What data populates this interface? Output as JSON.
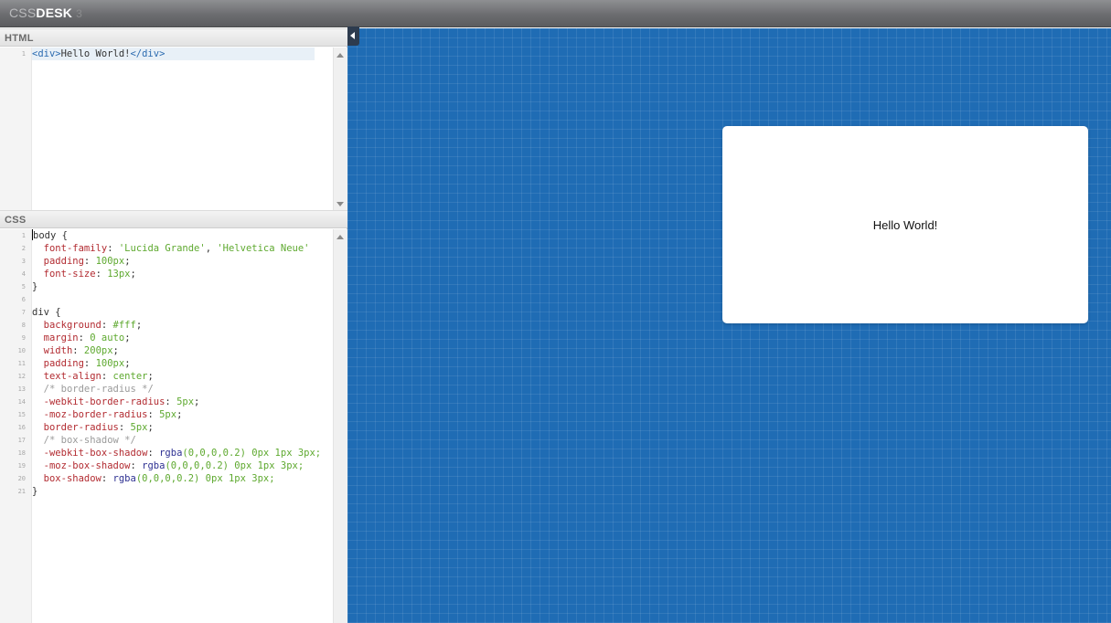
{
  "app": {
    "logo_part1": "CSS",
    "logo_part2": "DESK",
    "logo_part3": "3"
  },
  "html_panel": {
    "title": "HTML",
    "lines": [
      [
        [
          "tag",
          "<div>"
        ],
        [
          "txt",
          "Hello World!"
        ],
        [
          "tag",
          "</div>"
        ]
      ]
    ]
  },
  "css_panel": {
    "title": "CSS",
    "lines": [
      [
        [
          "sel",
          "body {"
        ]
      ],
      [
        [
          "txt",
          "  "
        ],
        [
          "prop",
          "font-family"
        ],
        [
          "txt",
          ": "
        ],
        [
          "val",
          "'Lucida Grande'"
        ],
        [
          "txt",
          ", "
        ],
        [
          "val",
          "'Helvetica Neue'"
        ]
      ],
      [
        [
          "txt",
          "  "
        ],
        [
          "prop",
          "padding"
        ],
        [
          "txt",
          ": "
        ],
        [
          "val",
          "100px"
        ],
        [
          "txt",
          ";"
        ]
      ],
      [
        [
          "txt",
          "  "
        ],
        [
          "prop",
          "font-size"
        ],
        [
          "txt",
          ": "
        ],
        [
          "val",
          "13px"
        ],
        [
          "txt",
          ";"
        ]
      ],
      [
        [
          "sel",
          "}"
        ]
      ],
      [],
      [
        [
          "sel",
          "div {"
        ]
      ],
      [
        [
          "txt",
          "  "
        ],
        [
          "prop",
          "background"
        ],
        [
          "txt",
          ": "
        ],
        [
          "val",
          "#fff"
        ],
        [
          "txt",
          ";"
        ]
      ],
      [
        [
          "txt",
          "  "
        ],
        [
          "prop",
          "margin"
        ],
        [
          "txt",
          ": "
        ],
        [
          "val",
          "0 auto"
        ],
        [
          "txt",
          ";"
        ]
      ],
      [
        [
          "txt",
          "  "
        ],
        [
          "prop",
          "width"
        ],
        [
          "txt",
          ": "
        ],
        [
          "val",
          "200px"
        ],
        [
          "txt",
          ";"
        ]
      ],
      [
        [
          "txt",
          "  "
        ],
        [
          "prop",
          "padding"
        ],
        [
          "txt",
          ": "
        ],
        [
          "val",
          "100px"
        ],
        [
          "txt",
          ";"
        ]
      ],
      [
        [
          "txt",
          "  "
        ],
        [
          "prop",
          "text-align"
        ],
        [
          "txt",
          ": "
        ],
        [
          "val",
          "center"
        ],
        [
          "txt",
          ";"
        ]
      ],
      [
        [
          "txt",
          "  "
        ],
        [
          "cmt",
          "/* border-radius */"
        ]
      ],
      [
        [
          "txt",
          "  "
        ],
        [
          "prop",
          "-webkit-border-radius"
        ],
        [
          "txt",
          ": "
        ],
        [
          "val",
          "5px"
        ],
        [
          "txt",
          ";"
        ]
      ],
      [
        [
          "txt",
          "  "
        ],
        [
          "prop",
          "-moz-border-radius"
        ],
        [
          "txt",
          ": "
        ],
        [
          "val",
          "5px"
        ],
        [
          "txt",
          ";"
        ]
      ],
      [
        [
          "txt",
          "  "
        ],
        [
          "prop",
          "border-radius"
        ],
        [
          "txt",
          ": "
        ],
        [
          "val",
          "5px"
        ],
        [
          "txt",
          ";"
        ]
      ],
      [
        [
          "txt",
          "  "
        ],
        [
          "cmt",
          "/* box-shadow */"
        ]
      ],
      [
        [
          "txt",
          "  "
        ],
        [
          "prop",
          "-webkit-box-shadow"
        ],
        [
          "txt",
          ": "
        ],
        [
          "fn",
          "rgba"
        ],
        [
          "val",
          "(0,0,0,0.2) 0px 1px 3px;"
        ]
      ],
      [
        [
          "txt",
          "  "
        ],
        [
          "prop",
          "-moz-box-shadow"
        ],
        [
          "txt",
          ": "
        ],
        [
          "fn",
          "rgba"
        ],
        [
          "val",
          "(0,0,0,0.2) 0px 1px 3px;"
        ]
      ],
      [
        [
          "txt",
          "  "
        ],
        [
          "prop",
          "box-shadow"
        ],
        [
          "txt",
          ": "
        ],
        [
          "fn",
          "rgba"
        ],
        [
          "val",
          "(0,0,0,0.2) 0px 1px 3px;"
        ]
      ],
      [
        [
          "sel",
          "}"
        ]
      ]
    ]
  },
  "preview": {
    "text": "Hello World!",
    "background_color": "#1f6cb4"
  }
}
